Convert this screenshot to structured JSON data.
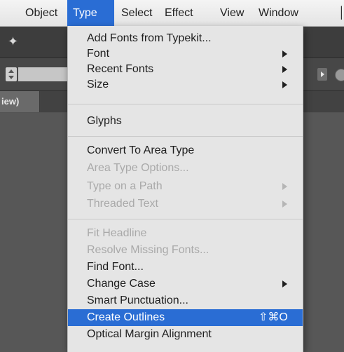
{
  "menubar": {
    "items": [
      {
        "label": "Object"
      },
      {
        "label": "Type"
      },
      {
        "label": "Select"
      },
      {
        "label": "Effect"
      },
      {
        "label": "View"
      },
      {
        "label": "Window"
      }
    ]
  },
  "app": {
    "doc_tab_label": "iew)",
    "icons": {
      "toolbar": "brush-icon",
      "control": "globe-icon"
    }
  },
  "type_menu": {
    "items": [
      {
        "label": "Add Fonts from Typekit...",
        "enabled": true
      },
      {
        "label": "Font",
        "enabled": true,
        "submenu": true
      },
      {
        "label": "Recent Fonts",
        "enabled": true,
        "submenu": true
      },
      {
        "label": "Size",
        "enabled": true,
        "submenu": true
      },
      {
        "label": "Glyphs",
        "enabled": true
      },
      {
        "label": "Convert To Area Type",
        "enabled": true
      },
      {
        "label": "Area Type Options...",
        "enabled": false
      },
      {
        "label": "Type on a Path",
        "enabled": false,
        "submenu": true
      },
      {
        "label": "Threaded Text",
        "enabled": false,
        "submenu": true
      },
      {
        "label": "Fit Headline",
        "enabled": false
      },
      {
        "label": "Resolve Missing Fonts...",
        "enabled": false
      },
      {
        "label": "Find Font...",
        "enabled": true
      },
      {
        "label": "Change Case",
        "enabled": true,
        "submenu": true
      },
      {
        "label": "Smart Punctuation...",
        "enabled": true
      },
      {
        "label": "Create Outlines",
        "enabled": true,
        "selected": true,
        "shortcut": "⇧⌘O"
      },
      {
        "label": "Optical Margin Alignment",
        "enabled": true
      }
    ]
  },
  "colors": {
    "highlight": "#2a6dd4",
    "menu_background": "#e5e5e5",
    "disabled_text": "#a9a9a9"
  }
}
